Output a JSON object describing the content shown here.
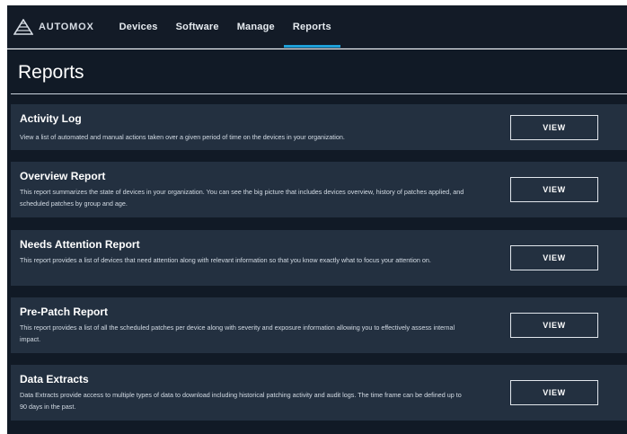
{
  "brand": {
    "name": "AUTOMOX"
  },
  "nav": [
    {
      "label": "Devices",
      "active": false
    },
    {
      "label": "Software",
      "active": false
    },
    {
      "label": "Manage",
      "active": false
    },
    {
      "label": "Reports",
      "active": true
    }
  ],
  "page": {
    "title": "Reports"
  },
  "reports": [
    {
      "title": "Activity Log",
      "description": "View a list of automated and manual actions taken over a given period of time on the devices in your organization.",
      "button": "VIEW"
    },
    {
      "title": "Overview Report",
      "description": "This report summarizes the state of devices in your organization. You can see the big picture that includes devices overview, history of patches applied, and scheduled patches by group and age.",
      "button": "VIEW"
    },
    {
      "title": "Needs Attention Report",
      "description": "This report provides a list of devices that need attention along with relevant information so that you know exactly what to focus your attention on.",
      "button": "VIEW"
    },
    {
      "title": "Pre-Patch Report",
      "description": "This report provides a list of all the scheduled patches per device along with severity and exposure information allowing you to effectively assess internal impact.",
      "button": "VIEW"
    },
    {
      "title": "Data Extracts",
      "description": "Data Extracts provide access to multiple types of data to download including historical patching activity and audit logs. The time frame can be defined up to 90 days in the past.",
      "button": "VIEW"
    }
  ],
  "colors": {
    "topbar": "#131b27",
    "background": "#111a26",
    "card": "#233040",
    "accent": "#1fa0d8"
  }
}
